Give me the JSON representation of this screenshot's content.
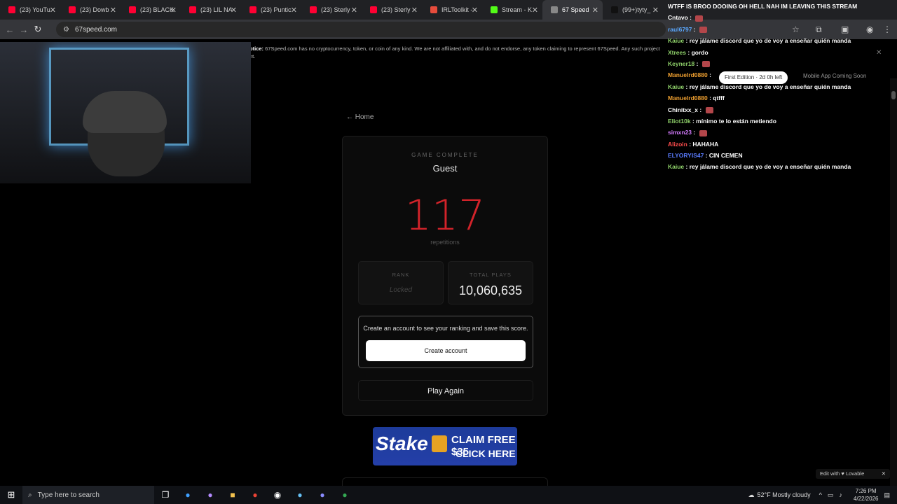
{
  "browser": {
    "tabs": [
      {
        "label": "(23) YouTu",
        "color": "#ff0033"
      },
      {
        "label": "(23) Dowb",
        "color": "#ff0033"
      },
      {
        "label": "(23) BLACK",
        "color": "#ff0033"
      },
      {
        "label": "(23) LIL NA",
        "color": "#ff0033"
      },
      {
        "label": "(23) Puntic",
        "color": "#ff0033"
      },
      {
        "label": "(23) Sterly",
        "color": "#ff0033"
      },
      {
        "label": "(23) Sterly",
        "color": "#ff0033"
      },
      {
        "label": "IRLToolkit -",
        "color": "#e74c3c"
      },
      {
        "label": "Stream - K",
        "color": "#53fc18"
      },
      {
        "label": "67 Speed",
        "color": "#888888"
      },
      {
        "label": "(99+)tyty_",
        "color": "#111111"
      }
    ],
    "url": "67speed.com"
  },
  "page": {
    "notice_bold": "otice:",
    "notice_text": "67Speed.com has no cryptocurrency, token, or coin of any kind. We are not affiliated with, and do not endorse, any token claiming to represent 67Speed. Any such project",
    "notice_more": "nt.",
    "home_link": "← Home",
    "edition_pill": "First Edition · 2d 0h left",
    "mobile_note": "Mobile App Coming Soon",
    "result": {
      "status": "GAME COMPLETE",
      "player": "Guest",
      "score": "117",
      "score_unit": "repetitions",
      "rank_label": "RANK",
      "rank_value": "Locked",
      "plays_label": "TOTAL PLAYS",
      "plays_value": "10,060,635",
      "cta_message": "Create an account to see your ranking and save this score.",
      "cta_button": "Create account",
      "play_again": "Play Again"
    },
    "ad": {
      "brand": "Stake",
      "line1": "CLAIM FREE $35",
      "line2": "CLICK HERE"
    },
    "edit_badge": "Edit with ♥ Lovable"
  },
  "chat": [
    {
      "user": "",
      "msg": "WTFF IS BROO DOOING OH HELL NAH IM LEAVING THIS STREAM",
      "color": "#ff4d4d"
    },
    {
      "user": "Cntavo",
      "msg": "",
      "color": "#ffffff",
      "emote": true
    },
    {
      "user": "raul6797",
      "msg": "",
      "color": "#5aa8ff",
      "emote": true
    },
    {
      "user": "Kaiue",
      "msg": "rey jálame discord que yo de voy a enseñar quién manda",
      "color": "#8fd16a"
    },
    {
      "user": "Xtrees",
      "msg": "gordo",
      "color": "#8fd16a"
    },
    {
      "user": "Keyner18",
      "msg": "",
      "color": "#8fd16a",
      "emote": true
    },
    {
      "user": "Manuelrd0880",
      "msg": "",
      "color": "#f0a030"
    },
    {
      "user": "Kaiue",
      "msg": "rey jálame discord que yo de voy a enseñar quién manda",
      "color": "#8fd16a"
    },
    {
      "user": "Manuelrd0880",
      "msg": "qtfff",
      "color": "#f0a030"
    },
    {
      "user": "Chinitxx_x",
      "msg": "",
      "color": "#ffffff",
      "emote": true
    },
    {
      "user": "Eliot10k",
      "msg": "mínimo te lo están metiendo",
      "color": "#8fd16a"
    },
    {
      "user": "simxn23",
      "msg": "",
      "color": "#d57bff",
      "emote": true
    },
    {
      "user": "Alizoin",
      "msg": "HAHAHA",
      "color": "#ff4d4d"
    },
    {
      "user": "ELYORYIS47",
      "msg": "CIN CEMEN",
      "color": "#5a7cff"
    },
    {
      "user": "Kaiue",
      "msg": "rey jálame discord que yo de voy a enseñar quién manda",
      "color": "#8fd16a"
    }
  ],
  "taskbar": {
    "search_placeholder": "Type here to search",
    "weather": "52°F  Mostly cloudy",
    "time": "7:26 PM",
    "date": "4/22/2026"
  }
}
